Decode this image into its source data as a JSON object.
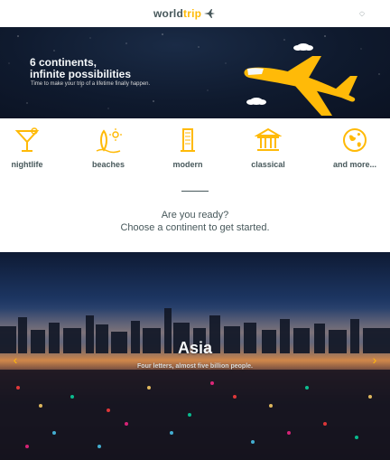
{
  "header": {
    "logo_world": "world",
    "logo_trip": "trip",
    "icon_names": {
      "logo_plane": "plane-icon",
      "right": "small-dot-icon"
    }
  },
  "banner": {
    "headline_line1": "6 continents,",
    "headline_line2": "infinite possibilities",
    "subtitle": "Time to make your trip of a lifetime finally happen.",
    "colors": {
      "accent": "#ffba08",
      "headline": "#f5f8fa"
    }
  },
  "types": [
    {
      "label": "nightlife",
      "icon": "cocktail-icon"
    },
    {
      "label": "beaches",
      "icon": "surfboard-icon"
    },
    {
      "label": "modern",
      "icon": "building-icon"
    },
    {
      "label": "classical",
      "icon": "museum-icon"
    },
    {
      "label": "and more...",
      "icon": "earth-icon"
    }
  ],
  "cta": {
    "line1": "Are you ready?",
    "line2": "Choose a continent to get started."
  },
  "slider": {
    "title": "Asia",
    "subtitle": "Four letters, almost five billion people.",
    "icons": {
      "prev": "chevron-left-icon",
      "next": "chevron-right-icon"
    }
  },
  "colors": {
    "text": "#47585b",
    "accent": "#ffba08",
    "light_text": "#dadada"
  }
}
